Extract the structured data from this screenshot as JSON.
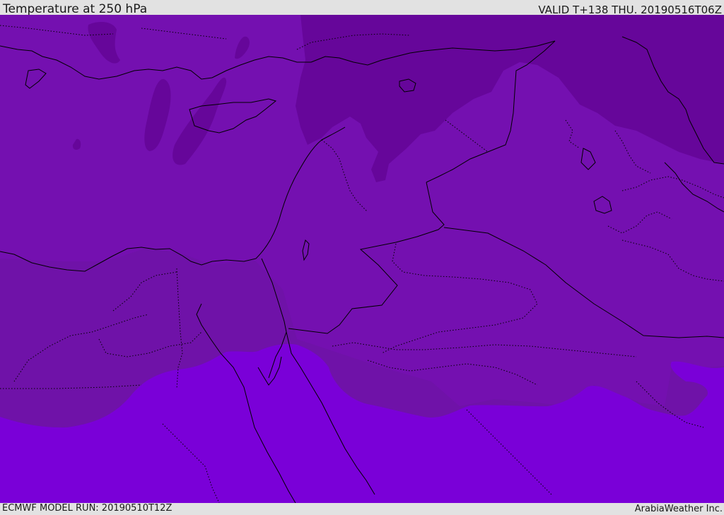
{
  "header": {
    "title": "Temperature at 250 hPa",
    "valid_time": "VALID T+138 THU. 20190516T06Z"
  },
  "footer": {
    "model_run": "ECMWF MODEL RUN: 20190510T12Z",
    "credit": "ArabiaWeather Inc."
  },
  "map": {
    "colors": {
      "base": "#7410b0",
      "mid": "#6f12a8",
      "cold": "#66069a",
      "warm": "#7a00d8",
      "border": "#000000"
    },
    "regions_shown": [
      "cold-band-north",
      "base-band",
      "mid-band",
      "warm-band-south"
    ]
  }
}
